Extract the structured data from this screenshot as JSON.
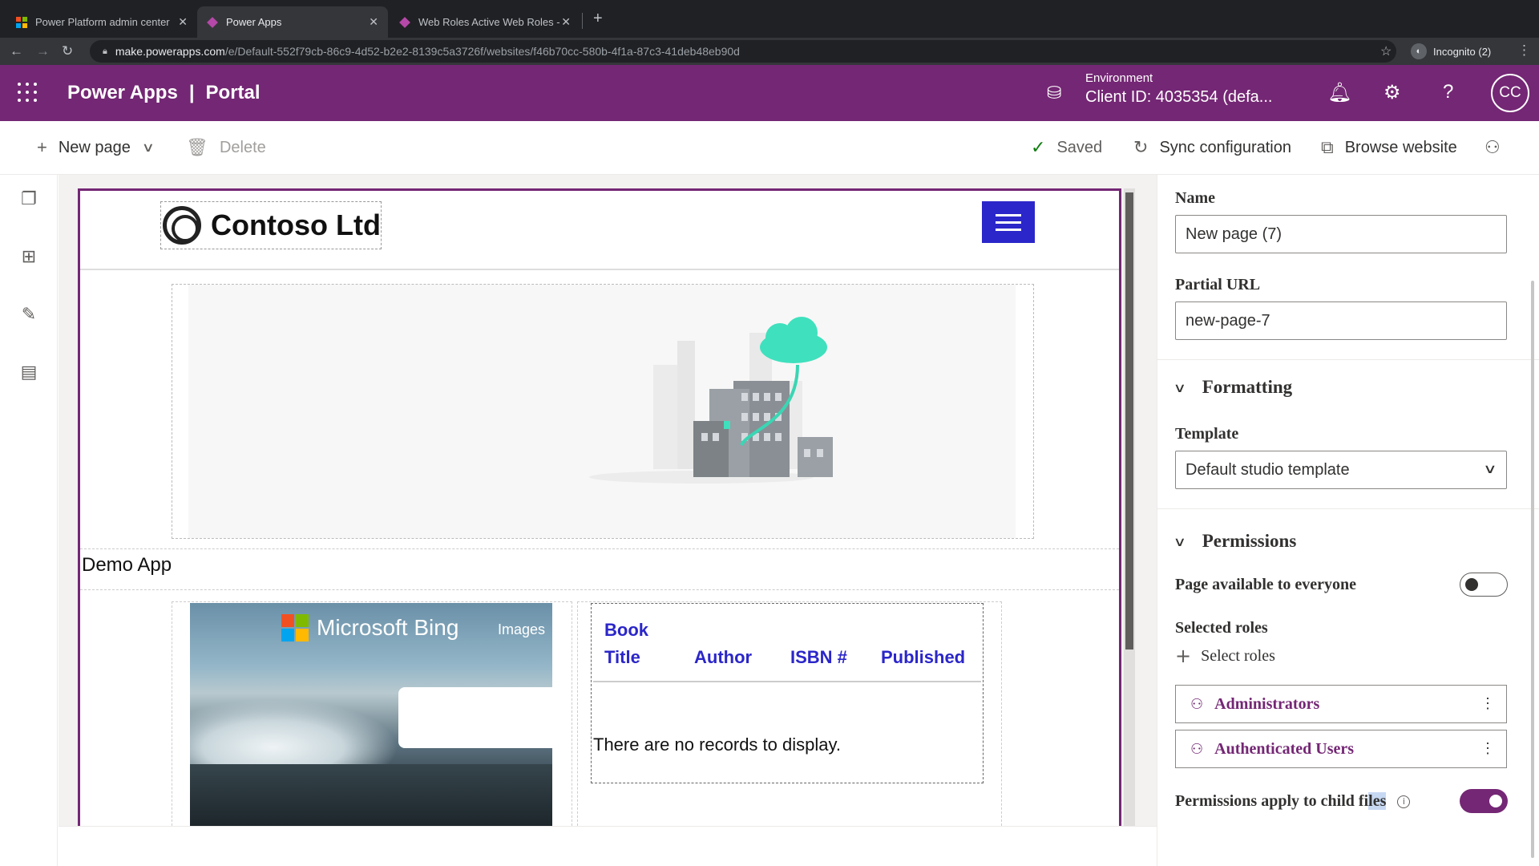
{
  "browser": {
    "tabs": [
      {
        "title": "Power Platform admin center"
      },
      {
        "title": "Power Apps"
      },
      {
        "title": "Web Roles Active Web Roles -"
      }
    ],
    "url_host": "make.powerapps.com",
    "url_path": "/e/Default-552f79cb-86c9-4d52-b2e2-8139c5a3726f/websites/f46b70cc-580b-4f1a-87c3-41deb48eb90d",
    "incognito_label": "Incognito (2)"
  },
  "header": {
    "app_name": "Power Apps",
    "separator": "|",
    "section": "Portal",
    "environment_label": "Environment",
    "environment_value": "Client ID: 4035354 (defa...",
    "avatar_initials": "CC",
    "brand_color": "#742774"
  },
  "toolbar": {
    "new_page": "New page",
    "delete": "Delete",
    "saved": "Saved",
    "sync": "Sync configuration",
    "browse": "Browse website"
  },
  "canvas": {
    "logo_text": "Contoso Ltd",
    "demo_title": "Demo App",
    "bing": {
      "brand": "Microsoft Bing",
      "images": "Images"
    },
    "list": {
      "headers": [
        "Book Title",
        "Author",
        "ISBN #",
        "Published"
      ],
      "header_line1": "Book",
      "header_line2": "Title",
      "empty": "There are no records to display."
    },
    "accent_color": "#2b26c9"
  },
  "panel": {
    "name_label": "Name",
    "name_value": "New page (7)",
    "url_label": "Partial URL",
    "url_value": "new-page-7",
    "formatting_label": "Formatting",
    "template_label": "Template",
    "template_value": "Default studio template",
    "permissions_label": "Permissions",
    "everyone_label": "Page available to everyone",
    "everyone_on": false,
    "selected_roles_label": "Selected roles",
    "select_roles": "Select roles",
    "roles": [
      "Administrators",
      "Authenticated Users"
    ],
    "child_label_a": "Permissions apply to child fi",
    "child_label_hl": "les",
    "child_on": true
  }
}
